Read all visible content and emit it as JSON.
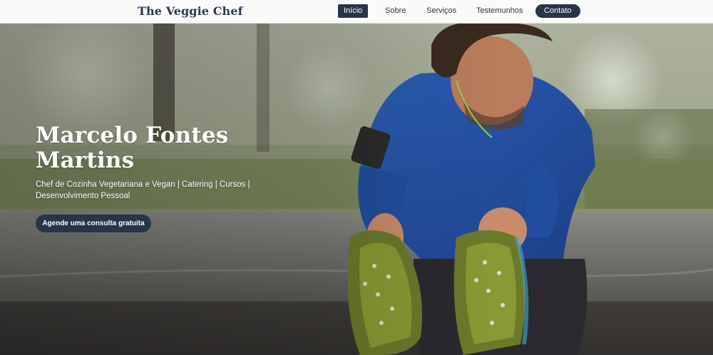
{
  "header": {
    "brand": "The Veggie Chef",
    "nav": [
      {
        "label": "Início",
        "active": true
      },
      {
        "label": "Sobre",
        "active": false
      },
      {
        "label": "Serviços",
        "active": false
      },
      {
        "label": "Testemunhos",
        "active": false
      },
      {
        "label": "Contato",
        "style": "pill"
      }
    ]
  },
  "hero": {
    "title": "Marcelo Fontes Martins",
    "subtitle": "Chef de Cozinha Vegetariana e Vegan | Catering | Cursos | Desenvolvimento Pessoal",
    "cta_label": "Agende uma consulta gratuita",
    "image": "hero-photo-man-stretching-on-road"
  },
  "colors": {
    "brand_navy": "#263547",
    "header_bg": "#fafafa",
    "hero_text": "#ffffff"
  }
}
